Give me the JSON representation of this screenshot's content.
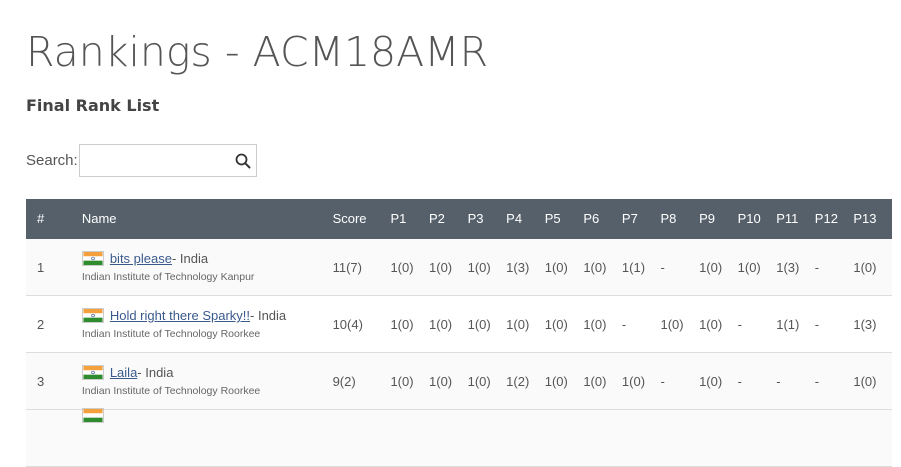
{
  "page": {
    "title": "Rankings - ACM18AMR",
    "subtitle": "Final Rank List"
  },
  "search": {
    "label": "Search:",
    "value": "",
    "placeholder": ""
  },
  "table": {
    "header_color": "#55606a",
    "columns": [
      "#",
      "Name",
      "Score",
      "P1",
      "P2",
      "P3",
      "P4",
      "P5",
      "P6",
      "P7",
      "P8",
      "P9",
      "P10",
      "P11",
      "P12",
      "P13"
    ],
    "rows": [
      {
        "rank": "1",
        "team": "bits please",
        "country": " - India",
        "institution": "Indian Institute of Technology Kanpur",
        "score": "11(7)",
        "problems": [
          "1(0)",
          "1(0)",
          "1(0)",
          "1(3)",
          "1(0)",
          "1(0)",
          "1(1)",
          "-",
          "1(0)",
          "1(0)",
          "1(3)",
          "-",
          "1(0)"
        ]
      },
      {
        "rank": "2",
        "team": "Hold right there Sparky!!",
        "country": " - India",
        "institution": "Indian Institute of Technology Roorkee",
        "score": "10(4)",
        "problems": [
          "1(0)",
          "1(0)",
          "1(0)",
          "1(0)",
          "1(0)",
          "1(0)",
          "-",
          "1(0)",
          "1(0)",
          "-",
          "1(1)",
          "-",
          "1(3)"
        ]
      },
      {
        "rank": "3",
        "team": "Laila",
        "country": " - India",
        "institution": "Indian Institute of Technology Roorkee",
        "score": "9(2)",
        "problems": [
          "1(0)",
          "1(0)",
          "1(0)",
          "1(2)",
          "1(0)",
          "1(0)",
          "1(0)",
          "-",
          "1(0)",
          "-",
          "-",
          "-",
          "1(0)"
        ]
      },
      {
        "rank": "",
        "team": "",
        "country": "",
        "institution": "",
        "score": "",
        "problems": [
          "",
          "",
          "",
          "",
          "",
          "",
          "",
          "",
          "",
          "",
          "",
          "",
          ""
        ]
      }
    ]
  }
}
